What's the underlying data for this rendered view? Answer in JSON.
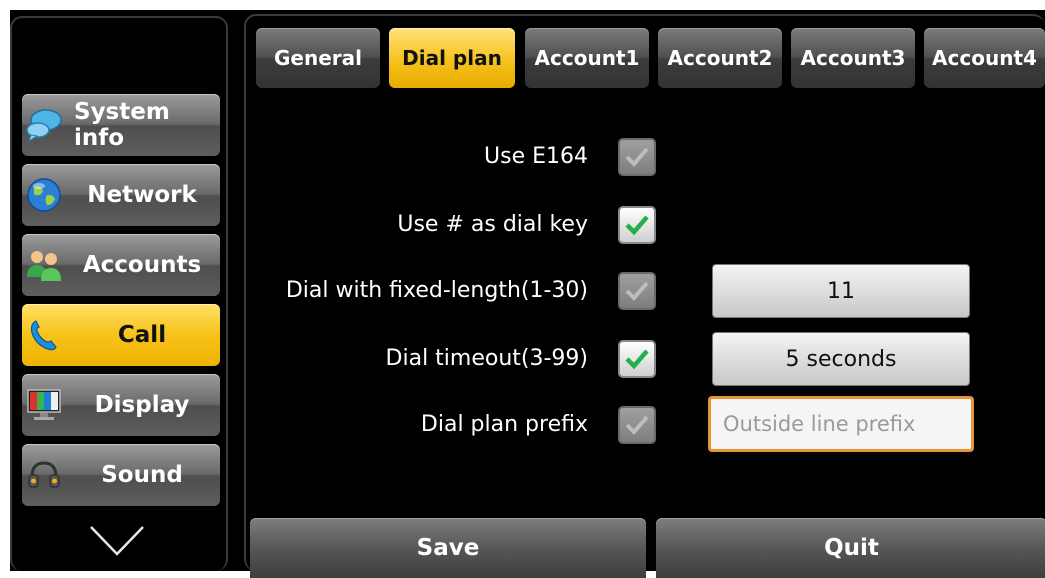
{
  "sidebar": {
    "items": [
      {
        "label": "System info",
        "icon": "chat-bubbles-icon",
        "active": false
      },
      {
        "label": "Network",
        "icon": "globe-icon",
        "active": false
      },
      {
        "label": "Accounts",
        "icon": "users-icon",
        "active": false
      },
      {
        "label": "Call",
        "icon": "phone-handset-icon",
        "active": true
      },
      {
        "label": "Display",
        "icon": "monitor-icon",
        "active": false
      },
      {
        "label": "Sound",
        "icon": "headset-icon",
        "active": false
      }
    ],
    "more_icon": "chevron-down-icon"
  },
  "tabs": [
    {
      "label": "General",
      "active": false
    },
    {
      "label": "Dial plan",
      "active": true
    },
    {
      "label": "Account1",
      "active": false
    },
    {
      "label": "Account2",
      "active": false
    },
    {
      "label": "Account3",
      "active": false
    },
    {
      "label": "Account4",
      "active": false
    }
  ],
  "settings": {
    "use_e164": {
      "label": "Use E164",
      "checked": false
    },
    "use_hash": {
      "label": "Use # as dial key",
      "checked": true
    },
    "fixed_length": {
      "label": "Dial with fixed-length(1-30)",
      "checked": false,
      "value": "11"
    },
    "timeout": {
      "label": "Dial timeout(3-99)",
      "checked": true,
      "value": "5 seconds"
    },
    "prefix": {
      "label": "Dial plan prefix",
      "checked": false,
      "placeholder": "Outside line prefix",
      "value": ""
    }
  },
  "actions": {
    "save_label": "Save",
    "quit_label": "Quit"
  },
  "colors": {
    "active_yellow": "#f5c21c",
    "check_green": "#22b14c",
    "input_border": "#e79437",
    "background": "#000000"
  }
}
